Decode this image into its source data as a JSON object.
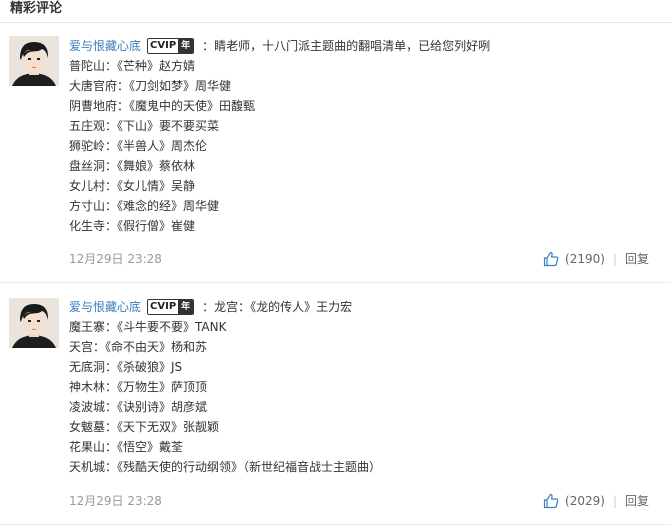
{
  "section": {
    "title": "精彩评论"
  },
  "comments": [
    {
      "user": "爱与恨藏心底",
      "badge": {
        "vip": "CVIP",
        "year": "年"
      },
      "lead": "：睛老师，十八门派主题曲的翻唱清单，已给您列好咧",
      "lines": [
        "普陀山：《芒种》赵方婧",
        "大唐官府：《刀剑如梦》周华健",
        "阴曹地府：《魔鬼中的天使》田馥甄",
        "五庄观：《下山》要不要买菜",
        "狮驼岭：《半兽人》周杰伦",
        "盘丝洞：《舞娘》蔡依林",
        "女儿村：《女儿情》吴静",
        "方寸山：《难念的经》周华健",
        "化生寺：《假行僧》崔健"
      ],
      "time": "12月29日 23:28",
      "likes": "(2190)",
      "reply": "回复"
    },
    {
      "user": "爱与恨藏心底",
      "badge": {
        "vip": "CVIP",
        "year": "年"
      },
      "lead": "：龙宫：《龙的传人》王力宏",
      "lines": [
        "魔王寨：《斗牛要不要》TANK",
        "天宫：《命不由天》杨和苏",
        "无底洞：《杀破狼》JS",
        "神木林：《万物生》萨顶顶",
        "凌波城：《诀别诗》胡彦斌",
        "女魃墓：《天下无双》张靓颖",
        "花果山：《悟空》戴荃",
        "天机城：《残酷天使的行动纲领》（新世纪福音战士主题曲）"
      ],
      "time": "12月29日 23:28",
      "likes": "(2029)",
      "reply": "回复"
    }
  ],
  "colors": {
    "username": "#3a7fc1",
    "like_icon": "#3a7fc1",
    "muted": "#999999"
  },
  "icons": {
    "like": "thumbs-up-icon",
    "avatar": "avatar-anime-boy"
  }
}
